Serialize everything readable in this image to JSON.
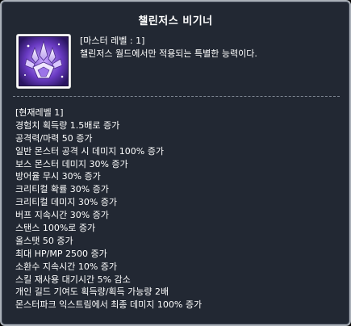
{
  "skill": {
    "name": "챌린저스 비기너",
    "level_info": "[마스터 레벨 : 1]",
    "description": "챌린저스 월드에서만 적용되는 특별한 능력이다.",
    "icon": "purple-crystal-emblem-icon"
  },
  "current_level": {
    "heading": "[현재레벨 1]",
    "effects": [
      "경험치 획득량 1.5배로 증가",
      "공격력/마력 50 증가",
      "일반 몬스터 공격 시 데미지 100% 증가",
      "보스 몬스터  데미지 30% 증가",
      "방어율 무시 30% 증가",
      "크리티컬 확률 30% 증가",
      "크리티컬 데미지 30% 증가",
      "버프 지속시간 30% 증가",
      "스탠스 100%로 증가",
      "올스탯 50 증가",
      "최대 HP/MP 2500 증가",
      "소환수 지속시간 10% 증가",
      "스킬 재사용 대기시간 5% 감소",
      "개인 길드 기여도 획득량/획득 가능량 2배",
      "몬스터파크 익스트림에서 최종 데미지 100% 증가"
    ]
  },
  "colors": {
    "background": "#222833",
    "border": "#aab0b8",
    "text": "#ffffff",
    "icon_primary": "#7b4fd0"
  }
}
